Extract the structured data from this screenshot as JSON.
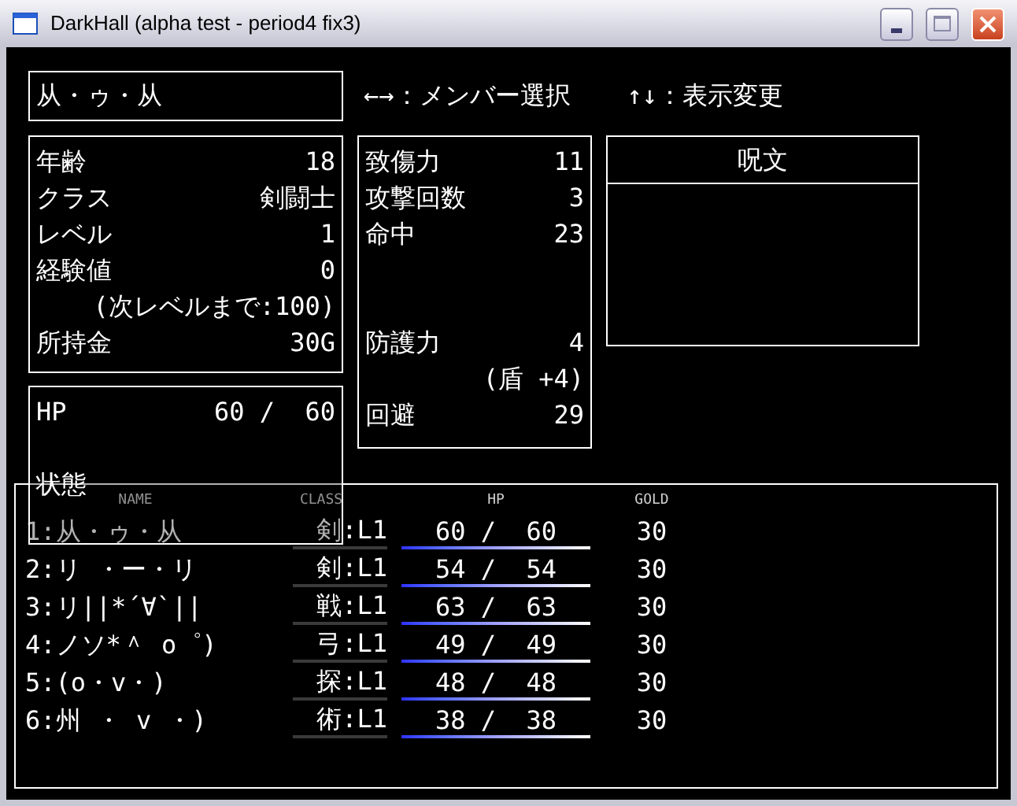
{
  "window": {
    "title": "DarkHall (alpha test - period4 fix3)"
  },
  "member_name": "从・ゥ・从",
  "hints": [
    "←→：メンバー選択",
    "↑↓：表示変更"
  ],
  "profile": [
    {
      "kind": "stat",
      "label": "年齢",
      "value": "18"
    },
    {
      "kind": "stat",
      "label": "クラス",
      "value": "剣闘士"
    },
    {
      "kind": "stat",
      "label": "レベル",
      "value": "1"
    },
    {
      "kind": "stat",
      "label": "経験値",
      "value": "0"
    },
    {
      "kind": "note",
      "value": "(次レベルまで:100)"
    },
    {
      "kind": "stat",
      "label": "所持金",
      "value": "30G"
    }
  ],
  "combat": {
    "offense": [
      {
        "kind": "stat",
        "label": "致傷力",
        "value": "11"
      },
      {
        "kind": "stat",
        "label": "攻撃回数",
        "value": "3"
      },
      {
        "kind": "stat",
        "label": "命中",
        "value": "23"
      }
    ],
    "defense": [
      {
        "kind": "stat",
        "label": "防護力",
        "value": "4"
      },
      {
        "kind": "note",
        "value": "(盾 +4)"
      },
      {
        "kind": "stat",
        "label": "回避",
        "value": "29"
      }
    ]
  },
  "spells": {
    "title": "呪文"
  },
  "vitals": {
    "hp_label": "HP",
    "hp": "60 /  60",
    "status_label": "状態"
  },
  "party": {
    "columns": [
      "NAME",
      "CLASS",
      "HP",
      "GOLD"
    ],
    "rows": [
      {
        "name": "1:从・ゥ・从",
        "class": "剣:L1",
        "hp": "60 /  60",
        "level": 1,
        "gold": "30"
      },
      {
        "name": "2:リ ・ー・リ",
        "class": "剣:L1",
        "hp": "54 /  54",
        "level": 1,
        "gold": "30"
      },
      {
        "name": "3:リ||*´∀`||",
        "class": "戦:L1",
        "hp": "63 /  63",
        "level": 1,
        "gold": "30"
      },
      {
        "name": "4:ノソ*＾ o゜)",
        "class": "弓:L1",
        "hp": "49 /  49",
        "level": 1,
        "gold": "30"
      },
      {
        "name": "5:(o・v・)",
        "class": "探:L1",
        "hp": "48 /  48",
        "level": 1,
        "gold": "30"
      },
      {
        "name": "6:州 ・ v ・)",
        "class": "術:L1",
        "hp": "38 /  38",
        "level": 1,
        "gold": "30"
      }
    ]
  }
}
